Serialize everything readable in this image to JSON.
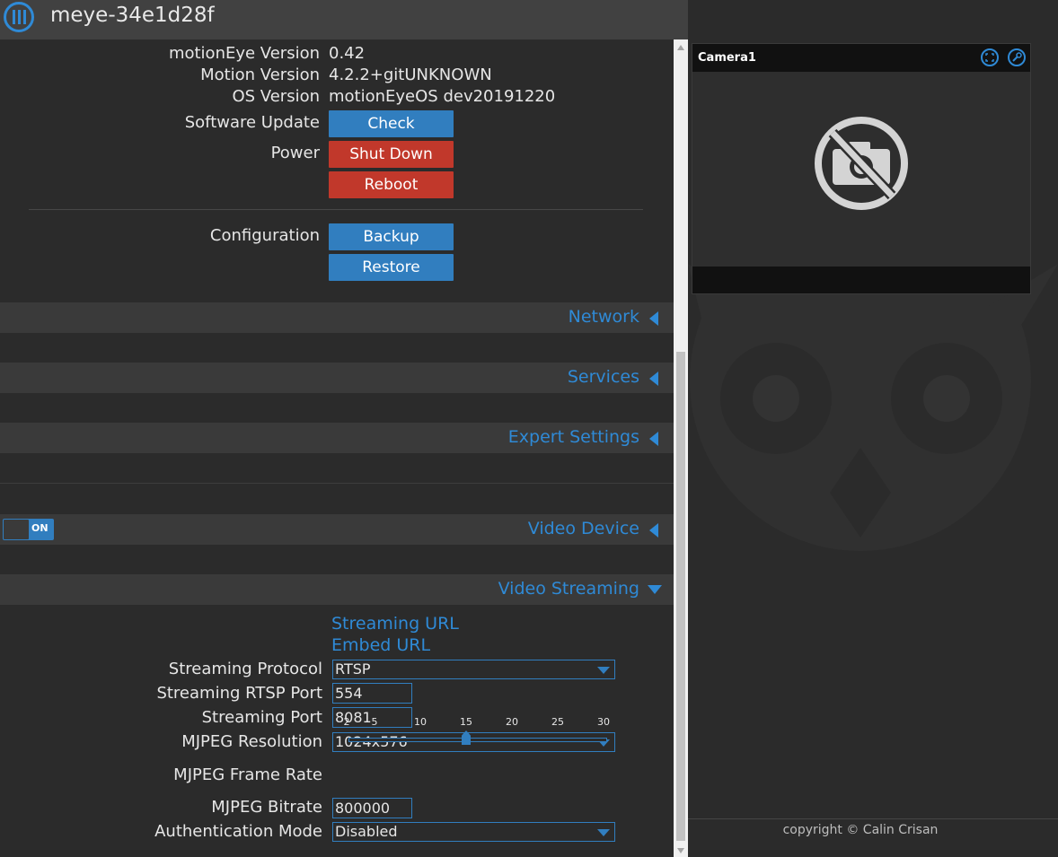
{
  "header": {
    "title": "meye-34e1d28f",
    "menu_icon": "menu-icon"
  },
  "info": [
    {
      "label": "motionEye Version",
      "value": "0.42"
    },
    {
      "label": "Motion Version",
      "value": "4.2.2+gitUNKNOWN"
    },
    {
      "label": "OS Version",
      "value": "motionEyeOS dev20191220"
    }
  ],
  "software_update": {
    "label": "Software Update",
    "button": "Check"
  },
  "power": {
    "label": "Power",
    "shutdown": "Shut Down",
    "reboot": "Reboot"
  },
  "configuration": {
    "label": "Configuration",
    "backup": "Backup",
    "restore": "Restore"
  },
  "sections": {
    "network": "Network",
    "services": "Services",
    "expert": "Expert Settings",
    "video_device": "Video Device",
    "video_streaming": "Video Streaming"
  },
  "video_device_toggle": "ON",
  "streaming": {
    "streaming_url": "Streaming URL",
    "embed_url": "Embed URL",
    "protocol_label": "Streaming Protocol",
    "protocol_value": "RTSP",
    "rtsp_port_label": "Streaming RTSP Port",
    "rtsp_port_value": "554",
    "port_label": "Streaming Port",
    "port_value": "8081",
    "resolution_label": "MJPEG Resolution",
    "resolution_value": "1024x576",
    "framerate_label": "MJPEG Frame Rate",
    "framerate_ticks": [
      "2",
      "5",
      "10",
      "15",
      "20",
      "25",
      "30"
    ],
    "framerate_value": 15,
    "bitrate_label": "MJPEG Bitrate",
    "bitrate_value": "800000",
    "auth_label": "Authentication Mode",
    "auth_value": "Disabled"
  },
  "camera": {
    "name": "Camera1",
    "fullscreen_icon": "fullscreen-icon",
    "settings_icon": "wrench-icon",
    "placeholder_icon": "no-camera-icon"
  },
  "footer": {
    "copyright": "copyright © Calin Crisan"
  },
  "colors": {
    "accent": "#2f8ad6",
    "button_blue": "#317ebf",
    "button_red": "#c1382b",
    "background": "#2b2b2b"
  }
}
